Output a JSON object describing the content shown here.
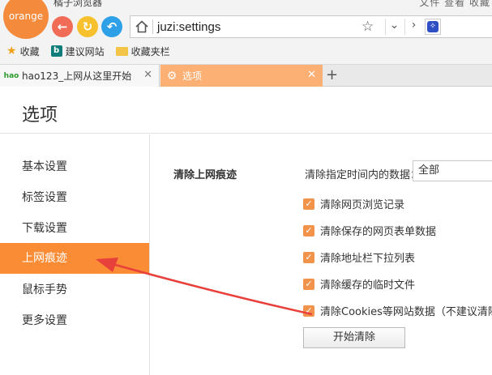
{
  "app": {
    "logo_text": "orange",
    "title": "橘子浏览器",
    "title_right": "文件  查看  收藏"
  },
  "address_bar": {
    "url": "juzi:settings"
  },
  "bookmarks": [
    {
      "label": "收藏",
      "icon": "star-icon"
    },
    {
      "label": "建议网站",
      "icon": "bing-icon"
    },
    {
      "label": "收藏夹栏",
      "icon": "folder-icon"
    }
  ],
  "tabs": [
    {
      "label": "hao123_上网从这里开始",
      "favicon": "hao123-icon",
      "active": false
    },
    {
      "label": "选项",
      "favicon": "gear-icon",
      "active": true
    }
  ],
  "new_tab_label": "+",
  "page": {
    "title": "选项"
  },
  "sidebar": {
    "items": [
      {
        "label": "基本设置",
        "active": false
      },
      {
        "label": "标签设置",
        "active": false
      },
      {
        "label": "下载设置",
        "active": false
      },
      {
        "label": "上网痕迹",
        "active": true
      },
      {
        "label": "鼠标手势",
        "active": false
      },
      {
        "label": "更多设置",
        "active": false
      }
    ]
  },
  "clear_history": {
    "section_label": "清除上网痕迹",
    "range_label": "清除指定时间内的数据：",
    "range_value": "全部",
    "options": [
      {
        "label": "清除网页浏览记录",
        "checked": true
      },
      {
        "label": "清除保存的网页表单数据",
        "checked": true
      },
      {
        "label": "清除地址栏下拉列表",
        "checked": true
      },
      {
        "label": "清除缓存的临时文件",
        "checked": true
      },
      {
        "label": "清除Cookies等网站数据（不建议清除）",
        "checked": true
      }
    ],
    "start_button": "开始清除"
  },
  "colors": {
    "accent": "#fa8c35",
    "active_tab": "#fdb074",
    "checkbox": "#f2934c",
    "annotation_arrow": "#e8403a"
  }
}
